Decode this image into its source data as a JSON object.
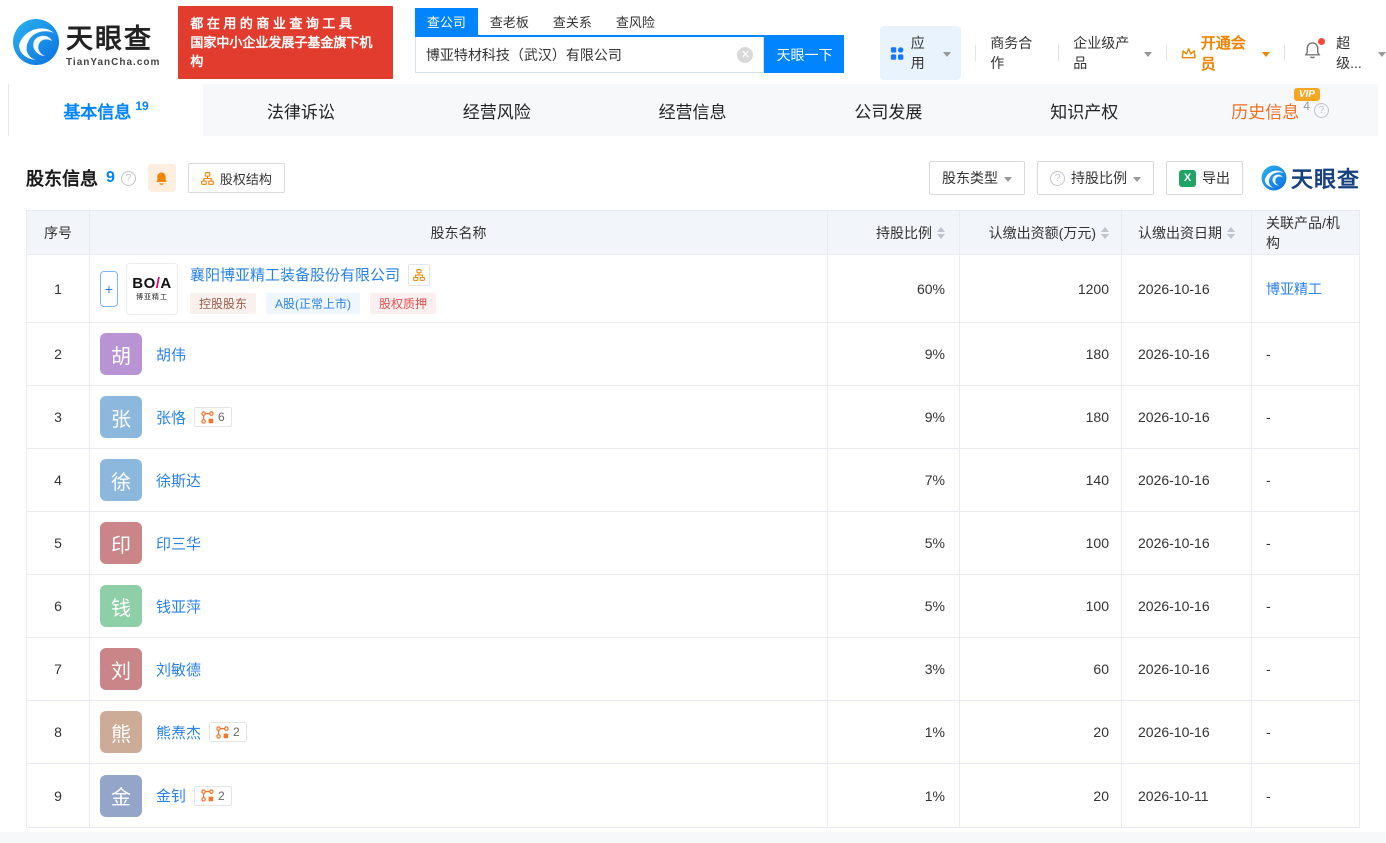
{
  "topbar": {
    "logo_title": "天眼查",
    "logo_sub": "TianYanCha.com",
    "slogan_line1": "都在用的商业查询工具",
    "slogan_line2": "国家中小企业发展子基金旗下机构",
    "search_tabs": [
      {
        "label": "查公司",
        "active": true
      },
      {
        "label": "查老板",
        "active": false
      },
      {
        "label": "查关系",
        "active": false
      },
      {
        "label": "查风险",
        "active": false
      }
    ],
    "search_value": "博亚特材科技（武汉）有限公司",
    "search_button": "天眼一下",
    "menu_app": "应用",
    "menu_biz": "商务合作",
    "menu_enterprise": "企业级产品",
    "menu_vip": "开通会员",
    "menu_super": "超级..."
  },
  "nav_tabs": [
    {
      "label": "基本信息",
      "count": "19",
      "active": true
    },
    {
      "label": "法律诉讼"
    },
    {
      "label": "经营风险"
    },
    {
      "label": "经营信息"
    },
    {
      "label": "公司发展"
    },
    {
      "label": "知识产权"
    },
    {
      "label": "历史信息",
      "count": "4",
      "vip": true
    }
  ],
  "section": {
    "title": "股东信息",
    "count": "9",
    "structure_button": "股权结构",
    "filter_type": "股东类型",
    "filter_ratio": "持股比例",
    "export_label": "导出",
    "watermark": "天眼查"
  },
  "table": {
    "columns": [
      "序号",
      "股东名称",
      "持股比例",
      "认缴出资额(万元)",
      "认缴出资日期",
      "关联产品/机构"
    ],
    "rows": [
      {
        "index": "1",
        "avatar": {
          "type": "logo",
          "line1": "BO/A",
          "line2": "博亚精工"
        },
        "expand": true,
        "name": "襄阳博亚精工装备股份有限公司",
        "chart_icon": true,
        "tags": [
          {
            "label": "控股股东",
            "style": "brown"
          },
          {
            "label": "A股(正常上市)",
            "style": "blue"
          },
          {
            "label": "股权质押",
            "style": "red"
          }
        ],
        "percent": "60%",
        "amount": "1200",
        "date": "2026-10-16",
        "related": "博亚精工",
        "related_link": true
      },
      {
        "index": "2",
        "avatar": {
          "type": "text",
          "char": "胡",
          "color": "#b894d4"
        },
        "name": "胡伟",
        "percent": "9%",
        "amount": "180",
        "date": "2026-10-16",
        "related": "-"
      },
      {
        "index": "3",
        "avatar": {
          "type": "text",
          "char": "张",
          "color": "#8cb8dd"
        },
        "name": "张恪",
        "badge": "6",
        "percent": "9%",
        "amount": "180",
        "date": "2026-10-16",
        "related": "-"
      },
      {
        "index": "4",
        "avatar": {
          "type": "text",
          "char": "徐",
          "color": "#8cb8dd"
        },
        "name": "徐斯达",
        "percent": "7%",
        "amount": "140",
        "date": "2026-10-16",
        "related": "-"
      },
      {
        "index": "5",
        "avatar": {
          "type": "text",
          "char": "印",
          "color": "#c98588"
        },
        "name": "印三华",
        "percent": "5%",
        "amount": "100",
        "date": "2026-10-16",
        "related": "-"
      },
      {
        "index": "6",
        "avatar": {
          "type": "text",
          "char": "钱",
          "color": "#8ecfa8"
        },
        "name": "钱亚萍",
        "percent": "5%",
        "amount": "100",
        "date": "2026-10-16",
        "related": "-"
      },
      {
        "index": "7",
        "avatar": {
          "type": "text",
          "char": "刘",
          "color": "#c98588"
        },
        "name": "刘敏德",
        "percent": "3%",
        "amount": "60",
        "date": "2026-10-16",
        "related": "-"
      },
      {
        "index": "8",
        "avatar": {
          "type": "text",
          "char": "熊",
          "color": "#ccac97"
        },
        "name": "熊焘杰",
        "badge": "2",
        "percent": "1%",
        "amount": "20",
        "date": "2026-10-16",
        "related": "-"
      },
      {
        "index": "9",
        "avatar": {
          "type": "text",
          "char": "金",
          "color": "#93a5c8"
        },
        "name": "金钊",
        "badge": "2",
        "percent": "1%",
        "amount": "20",
        "date": "2026-10-11",
        "related": "-"
      }
    ]
  },
  "colors": {
    "primary_blue": "#0084ff",
    "link_blue": "#2882e8",
    "orange": "#f08300",
    "slogan_red": "#e23c2e",
    "header_bg": "#f2f5fa",
    "tab_bar_bg": "#f7f8fa"
  }
}
